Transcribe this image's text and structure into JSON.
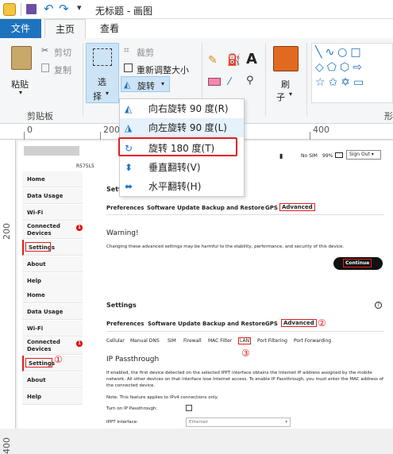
{
  "window": {
    "title": "无标题 - 画图"
  },
  "tabs": {
    "file": "文件",
    "home": "主页",
    "view": "查看"
  },
  "ribbon": {
    "paste": "粘贴",
    "cut": "剪切",
    "copy": "复制",
    "clipboard_group": "剪贴板",
    "select": "选",
    "select2": "择",
    "crop": "裁剪",
    "resize": "重新调整大小",
    "rotate": "旋转",
    "brush": "刷",
    "brush2": "子",
    "more": "形"
  },
  "rotate_menu": {
    "items": [
      "向右旋转 90 度(R)",
      "向左旋转 90 度(L)",
      "旋转 180 度(T)",
      "垂直翻转(V)",
      "水平翻转(H)"
    ]
  },
  "ruler": {
    "h": [
      "0",
      "200",
      "400"
    ],
    "v": [
      "200",
      "400"
    ]
  },
  "router": {
    "model": "R575L5",
    "status_sim": "No SIM",
    "status_batt": "99%",
    "signout": "Sign Out",
    "nav1": [
      "Home",
      "Data Usage",
      "Wi-Fi",
      "Connected Devices",
      "Settings",
      "About",
      "Help"
    ],
    "nav2": [
      "Home",
      "Data Usage",
      "Wi-Fi",
      "Connected Devices",
      "Settings",
      "About",
      "Help"
    ],
    "badge": "1",
    "section_title1": "Settin",
    "tabs1": [
      "Preferences",
      "Software Update",
      "Backup and Restore",
      "GPS",
      "Advanced"
    ],
    "warning_title": "Warning!",
    "warning_text": "Changing these advanced settings may be harmful to the stability, performance, and security of this device.",
    "continue": "Continue",
    "section_title2": "Settings",
    "tabs2": [
      "Preferences",
      "Software Update",
      "Backup and Restore",
      "GPS",
      "Advanced"
    ],
    "subtabs": [
      "Cellular",
      "Manual DNS",
      "SIM",
      "Firewall",
      "MAC Filter",
      "LAN",
      "Port Filtering",
      "Port Forwarding"
    ],
    "ip_title": "IP Passthrough",
    "ip_text": "If enabled, the first device detected on the selected IPPT interface obtains the Internet IP address assigned by the mobile network. All other devices on that interface lose Internet access. To enable IP Passthrough, you must enter the MAC address of the connected device.",
    "note": "Note: This feature applies to IPv4 connections only.",
    "turn_on": "Turn on IP Passthrough:",
    "interface": "IPPT Interface:",
    "interface_val": "Ethernet",
    "help": "?",
    "ann1": "①",
    "ann2": "②",
    "ann3": "③"
  }
}
